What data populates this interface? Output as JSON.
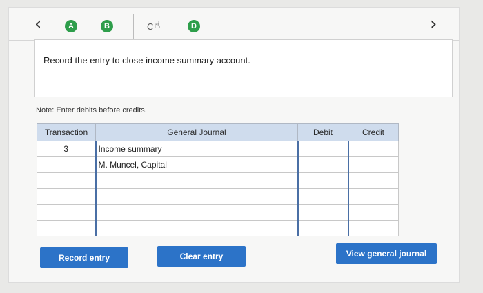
{
  "nav": {
    "prev": "‹",
    "next": "›",
    "tabs": [
      {
        "label": "A",
        "color": "#2e9e4b"
      },
      {
        "label": "B",
        "color": "#2e9e4b"
      },
      {
        "label": "C"
      },
      {
        "label": "D",
        "color": "#2e9e4b"
      }
    ]
  },
  "instruction": "Record the entry to close income summary account.",
  "note": "Note: Enter debits before credits.",
  "journal": {
    "headers": {
      "transaction": "Transaction",
      "general_journal": "General Journal",
      "debit": "Debit",
      "credit": "Credit"
    },
    "rows": [
      {
        "transaction": "3",
        "account": "Income summary",
        "debit": "",
        "credit": ""
      },
      {
        "transaction": "",
        "account": "M. Muncel, Capital",
        "debit": "",
        "credit": ""
      },
      {
        "transaction": "",
        "account": "",
        "debit": "",
        "credit": ""
      },
      {
        "transaction": "",
        "account": "",
        "debit": "",
        "credit": ""
      },
      {
        "transaction": "",
        "account": "",
        "debit": "",
        "credit": ""
      },
      {
        "transaction": "",
        "account": "",
        "debit": "",
        "credit": ""
      }
    ]
  },
  "buttons": {
    "record": "Record entry",
    "clear": "Clear entry",
    "view": "View general journal"
  },
  "colors": {
    "accent": "#2c73c8",
    "tab_complete": "#2e9e4b",
    "header_bg": "#cfdced"
  }
}
